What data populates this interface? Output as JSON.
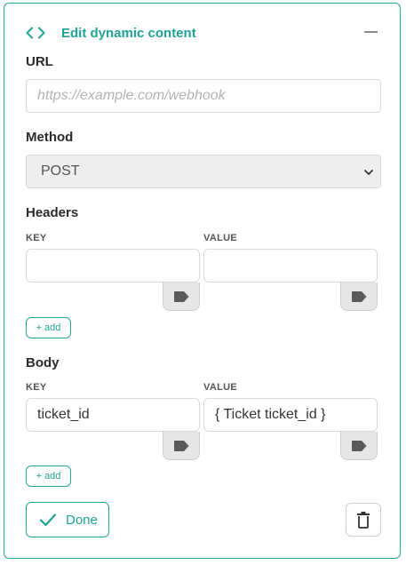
{
  "header": {
    "title": "Edit dynamic content",
    "icon": "code-icon",
    "collapse_icon": "minus-icon"
  },
  "url": {
    "label": "URL",
    "value": "",
    "placeholder": "https://example.com/webhook"
  },
  "method": {
    "label": "Method",
    "selected": "POST"
  },
  "headers": {
    "label": "Headers",
    "key_label": "KEY",
    "value_label": "VALUE",
    "rows": [
      {
        "key": "",
        "value": ""
      }
    ],
    "add_label": "+ add"
  },
  "body": {
    "label": "Body",
    "key_label": "KEY",
    "value_label": "VALUE",
    "rows": [
      {
        "key": "ticket_id",
        "value": "{ Ticket ticket_id }"
      }
    ],
    "add_label": "+ add"
  },
  "actions": {
    "done_label": "Done",
    "done_icon": "check-icon",
    "delete_icon": "trash-icon"
  },
  "colors": {
    "accent": "#25a69a",
    "text": "#2b2b2b",
    "border": "#d9d9d9"
  }
}
